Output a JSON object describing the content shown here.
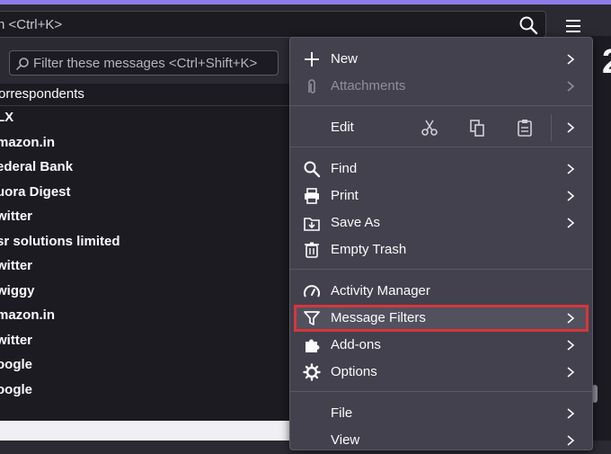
{
  "window": {
    "accent_color": "#8f7ce8"
  },
  "toolbar": {
    "search_text": "n <Ctrl+K>",
    "search_icon": "search-icon",
    "menu_icon": "hamburger-menu-icon"
  },
  "filter": {
    "placeholder": "Filter these messages <Ctrl+Shift+K>",
    "icon": "search-icon"
  },
  "list": {
    "header": "orrespondents",
    "rows": [
      "LX",
      "mazon.in",
      "ederal Bank",
      "uora Digest",
      "witter",
      "sr solutions limited",
      "witter",
      "wiggy",
      "mazon.in",
      "witter",
      "oogle",
      "oogle"
    ]
  },
  "right_fragment": {
    "digit": "2"
  },
  "menu": {
    "items": [
      {
        "label": "New",
        "icon": "plus-icon",
        "submenu": true,
        "disabled": false
      },
      {
        "label": "Attachments",
        "icon": "paperclip-icon",
        "submenu": true,
        "disabled": true
      },
      {
        "label": "Edit",
        "icon": "",
        "submenu": true,
        "disabled": false
      },
      {
        "label": "Find",
        "icon": "search-icon",
        "submenu": true,
        "disabled": false
      },
      {
        "label": "Print",
        "icon": "printer-icon",
        "submenu": true,
        "disabled": false
      },
      {
        "label": "Save As",
        "icon": "save-as-icon",
        "submenu": true,
        "disabled": false
      },
      {
        "label": "Empty Trash",
        "icon": "trash-icon",
        "submenu": false,
        "disabled": false
      },
      {
        "label": "Activity Manager",
        "icon": "gauge-icon",
        "submenu": false,
        "disabled": false
      },
      {
        "label": "Message Filters",
        "icon": "filter-icon",
        "submenu": true,
        "disabled": false,
        "highlighted": true
      },
      {
        "label": "Add-ons",
        "icon": "puzzle-icon",
        "submenu": true,
        "disabled": false
      },
      {
        "label": "Options",
        "icon": "gear-icon",
        "submenu": true,
        "disabled": false
      },
      {
        "label": "File",
        "icon": "",
        "submenu": true,
        "disabled": false
      },
      {
        "label": "View",
        "icon": "",
        "submenu": true,
        "disabled": false
      }
    ],
    "edit_tools": [
      "cut-icon",
      "copy-icon",
      "paste-icon"
    ],
    "highlight_color": "#d7363c"
  }
}
